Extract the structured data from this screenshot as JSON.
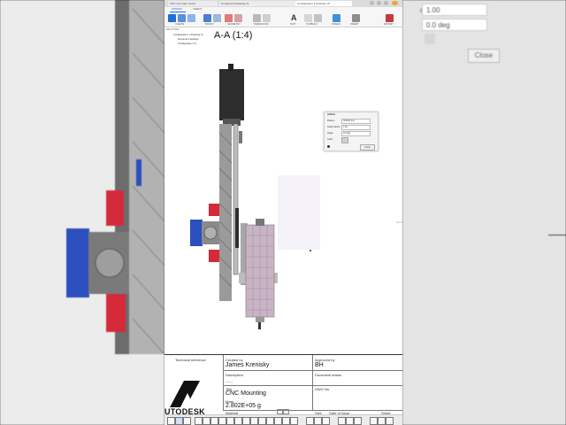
{
  "window": {
    "tabs": [
      {
        "label": "CNC cut router mount"
      },
      {
        "label": "Component Drawing v1"
      },
      {
        "label": "Configuration 1 Drawing v1*"
      }
    ]
  },
  "toolbar": {
    "groups": [
      {
        "label": "CREATE"
      },
      {
        "label": "MODIFY"
      },
      {
        "label": "GEOMETRY"
      },
      {
        "label": "DIMENSIONS"
      },
      {
        "label": "TEXT"
      },
      {
        "label": "SYMBOLS"
      },
      {
        "label": "TABLES"
      },
      {
        "label": "INSERT"
      },
      {
        "label": "EXPORT"
      }
    ],
    "workspace_tabs": [
      {
        "label": "DRAWING"
      },
      {
        "label": "SHEETS"
      }
    ]
  },
  "browser": {
    "header": "BROWSER",
    "items": [
      {
        "label": "Configuration 1 Drawing v1"
      },
      {
        "label": "Document Settings"
      },
      {
        "label": "Configuration 1:1"
      }
    ]
  },
  "view": {
    "title": "A-A (1:4)"
  },
  "dialog": {
    "title": "HATCH",
    "fields": [
      {
        "label": "Pattern",
        "value": "ANSI31 Iron"
      },
      {
        "label": "Scale Factor",
        "value": "1.00"
      },
      {
        "label": "Angle",
        "value": "0.0 deg"
      },
      {
        "label": "Color",
        "value": ""
      }
    ],
    "close_label": "Close"
  },
  "title_block": {
    "technical_reference_label": "Technical reference",
    "created_by_label": "Created by",
    "created_by": "James Krenisky",
    "approved_by_label": "Approved by",
    "approved_by": "BH",
    "description_label": "Description",
    "description": "------",
    "document_status_label": "Document status",
    "title_label": "Title",
    "title": "CNC Mounting",
    "dwg_no_label": "DWG No.",
    "mass_label": "Mass",
    "mass": "2.802E+05 g",
    "material_label": "Material",
    "size_label": "Size",
    "date_of_issue_label": "Date of issue",
    "sheet_label": "Sheet",
    "logo_text": "UTODESK"
  },
  "background": {
    "right_values": [
      {
        "label": "ctor",
        "value": "1.00"
      },
      {
        "label": "",
        "value": "0.0 deg"
      }
    ],
    "right_button": "Close"
  },
  "colors": {
    "accent_blue": "#1f6fd6",
    "part_red": "#d42a3a",
    "motor_blue": "#2b4fbe",
    "dark_motor": "#2d2d2d",
    "hatch_grey": "#9a9a9a",
    "spindle_purple": "#c9b4c6"
  }
}
